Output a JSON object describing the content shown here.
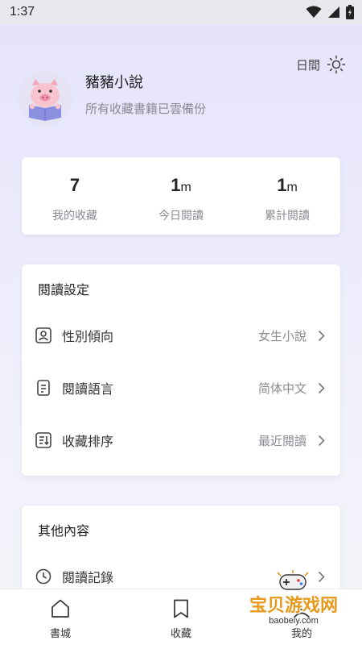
{
  "status_bar": {
    "time": "1:37"
  },
  "header": {
    "theme_label": "日間",
    "theme_icon": "sun-icon",
    "avatar_icon": "pig-reading-avatar",
    "username": "豬豬小說",
    "subtitle": "所有收藏書籍已雲備份"
  },
  "stats": [
    {
      "value": "7",
      "unit": "",
      "label": "我的收藏"
    },
    {
      "value": "1",
      "unit": "m",
      "label": "今日閱讀"
    },
    {
      "value": "1",
      "unit": "m",
      "label": "累計閱讀"
    }
  ],
  "reading_settings": {
    "title": "閱讀設定",
    "items": [
      {
        "icon": "person-icon",
        "label": "性別傾向",
        "value": "女生小說"
      },
      {
        "icon": "document-icon",
        "label": "閱讀語言",
        "value": "简体中文"
      },
      {
        "icon": "sort-icon",
        "label": "收藏排序",
        "value": "最近閱讀"
      }
    ]
  },
  "other": {
    "title": "其他內容",
    "items": [
      {
        "icon": "clock-icon",
        "label": "閱讀記錄"
      }
    ]
  },
  "bottom_nav": [
    {
      "icon": "home-icon",
      "label": "書城"
    },
    {
      "icon": "bookmark-icon",
      "label": "收藏"
    },
    {
      "icon": "profile-icon",
      "label": "我的"
    }
  ],
  "watermark": {
    "text": "宝贝游戏网",
    "url": "baobeiy.com"
  },
  "colors": {
    "accent": "#e69a1c",
    "background": "#e8e7fb",
    "card": "#ffffff"
  }
}
